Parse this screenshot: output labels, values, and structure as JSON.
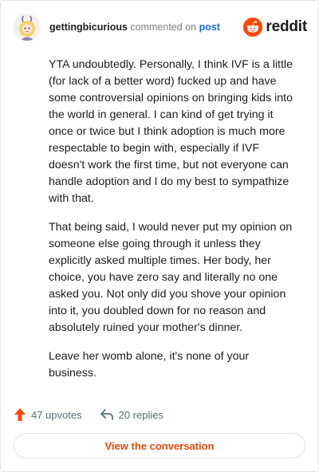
{
  "header": {
    "username": "gettingbicurious",
    "action_text": "commented on",
    "post_link": "post",
    "brand_word": "reddit"
  },
  "comment": {
    "paragraphs": [
      "YTA undoubtedly. Personally, I think IVF is a little (for lack of a better word) fucked up and have some controversial opinions on bringing kids into the world in general. I can kind of get trying it once or twice but I think adoption is much more respectable to begin with, especially if IVF doesn't work the first time, but not everyone can handle adoption and I do my best to sympathize with that.",
      "That being said, I would never put my opinion on someone else going through it unless they explicitly asked multiple times. Her body, her choice, you have zero say and literally no one asked you. Not only did you shove your opinion into it, you doubled down for no reason and absolutely ruined your mother's dinner.",
      "Leave her womb alone, it's none of your business."
    ]
  },
  "footer": {
    "upvotes_label": "47 upvotes",
    "replies_label": "20 replies",
    "cta_label": "View the conversation"
  },
  "colors": {
    "accent": "#e34b10",
    "upvote": "#ff4500",
    "link": "#1a6be0"
  },
  "icons": {
    "avatar": "avatar-image",
    "brand": "reddit-logo-icon",
    "upvote": "upvote-arrow-icon",
    "reply": "reply-arrow-icon"
  }
}
